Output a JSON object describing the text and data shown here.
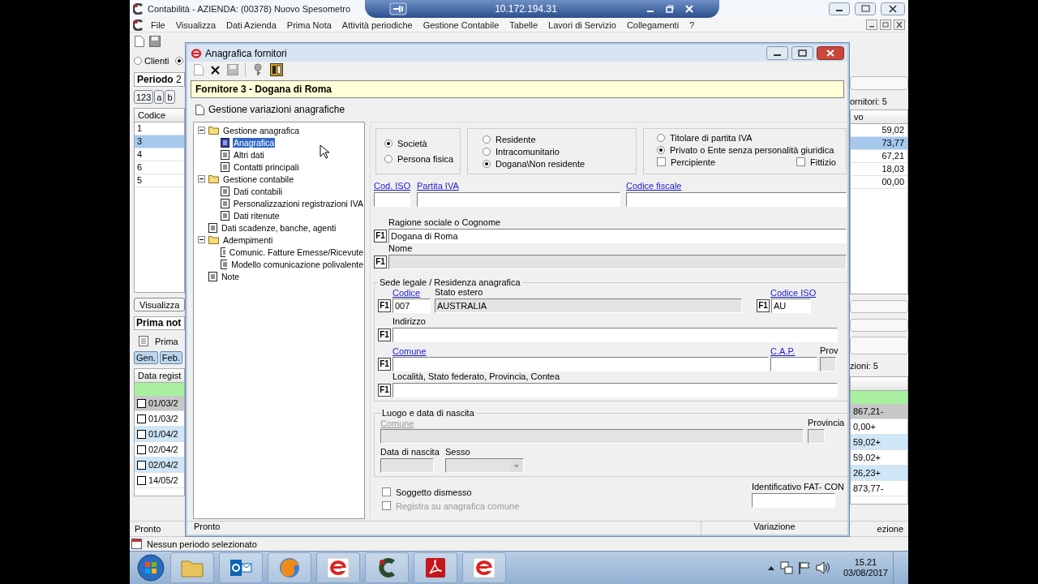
{
  "app": {
    "title": "Contabilità - AZIENDA:  (00378) Nuovo Spesometro",
    "menu": [
      "File",
      "Visualizza",
      "Dati Azienda",
      "Prima Nota",
      "Attività periodiche",
      "Gestione Contabile",
      "Tabelle",
      "Lavori di Servizio",
      "Collegamenti",
      "?"
    ],
    "filter_radios": [
      {
        "label": "Clienti",
        "selected": false
      },
      {
        "selected": true
      }
    ],
    "period_label": "Periodo",
    "period_value": "2",
    "index_buttons": [
      "123",
      "a",
      "b"
    ],
    "suppliers": {
      "column": "Codice",
      "count": "ornitori: 5",
      "column_2": "vo",
      "rows": [
        {
          "code": "1",
          "amount": "59,02",
          "selected": false
        },
        {
          "code": "3",
          "amount": "73,77",
          "selected": true
        },
        {
          "code": "4",
          "amount": "67,21",
          "selected": false
        },
        {
          "code": "6",
          "amount": "18,03",
          "selected": false
        },
        {
          "code": "5",
          "amount": "00,00",
          "selected": false
        }
      ]
    },
    "view_button": "Visualizza",
    "journal_title": "Prima not",
    "journal_item": "Prima",
    "month_tabs": [
      "Gen.",
      "Feb."
    ],
    "journal": {
      "column": "Data regist",
      "count": "zioni: 5",
      "rows": [
        {
          "date": "01/03/2",
          "amount": "867,21-",
          "selected": true
        },
        {
          "date": "01/03/2",
          "amount": "0,00+",
          "selected": false
        },
        {
          "date": "01/04/2",
          "amount": "59,02+",
          "selected": false
        },
        {
          "date": "02/04/2",
          "amount": "59,02+",
          "selected": false
        },
        {
          "date": "02/04/2",
          "amount": "26,23+",
          "selected": false
        },
        {
          "date": "14/05/2",
          "amount": "873,77-",
          "selected": false
        }
      ]
    },
    "status": "Pronto",
    "status_right": "ezione",
    "status_2": "Nessun periodo selezionato"
  },
  "remote_bar": {
    "address": "10.172.194.31"
  },
  "dialog": {
    "title": "Anagrafica fornitori",
    "header": "Fornitore 3 - Dogana di Roma",
    "link": "Gestione variazioni anagrafiche",
    "tree": [
      {
        "label": "Gestione anagrafica",
        "kind": "folder",
        "expanded": true,
        "selected": false,
        "children": [
          {
            "label": "Anagrafica",
            "kind": "page",
            "selected": true
          },
          {
            "label": "Altri dati",
            "kind": "page",
            "selected": false
          },
          {
            "label": "Contatti principali",
            "kind": "page",
            "selected": false
          }
        ]
      },
      {
        "label": "Gestione contabile",
        "kind": "folder",
        "expanded": true,
        "selected": false,
        "children": [
          {
            "label": "Dati contabili",
            "kind": "page",
            "selected": false
          },
          {
            "label": "Personalizzazioni registrazioni IVA",
            "kind": "page",
            "selected": false
          },
          {
            "label": "Dati ritenute",
            "kind": "page",
            "selected": false
          }
        ]
      },
      {
        "label": "Dati scadenze, banche, agenti",
        "kind": "page",
        "selected": false
      },
      {
        "label": "Adempimenti",
        "kind": "folder",
        "expanded": true,
        "selected": false,
        "children": [
          {
            "label": "Comunic. Fatture Emesse/Ricevute",
            "kind": "page",
            "selected": false
          },
          {
            "label": "Modello comunicazione polivalente",
            "kind": "page",
            "selected": false
          }
        ]
      },
      {
        "label": "Note",
        "kind": "page",
        "selected": false
      }
    ],
    "subject_type": [
      {
        "label": "Società",
        "selected": true
      },
      {
        "label": "Persona fisica",
        "selected": false
      }
    ],
    "residence": [
      {
        "label": "Residente",
        "selected": false
      },
      {
        "label": "Intracomunitario",
        "selected": false
      },
      {
        "label": "Dogana\\Non residente",
        "selected": true
      }
    ],
    "vat_status": [
      {
        "label": "Titolare di partita IVA",
        "selected": false
      },
      {
        "label": "Privato o Ente senza personalità giuridica",
        "selected": true
      }
    ],
    "flags": [
      {
        "label": "Percipiente",
        "checked": false
      },
      {
        "label": "Fittizio",
        "checked": false
      }
    ],
    "iso_label": "Cod. ISO",
    "vat_label": "Partita IVA",
    "tax_code_label": "Codice fiscale",
    "company_name": {
      "label": "Ragione sociale o Cognome",
      "value": "Dogana di Roma",
      "key": "F1"
    },
    "name": {
      "label": "Nome",
      "key": "F1",
      "disabled": true
    },
    "seat": {
      "title": "Sede legale / Residenza anagrafica",
      "code": {
        "label": "Codice",
        "value": "007",
        "key": "F1"
      },
      "country": {
        "label": "Stato estero",
        "value": "AUSTRALIA"
      },
      "iso": {
        "label": "Codice ISO",
        "value": "AU",
        "key": "F1"
      },
      "address": {
        "label": "Indirizzo",
        "key": "F1"
      },
      "city": {
        "label": "Comune",
        "key": "F1"
      },
      "zip": {
        "label": "C.A.P."
      },
      "prov": {
        "label": "Prov"
      },
      "locality": {
        "label": "Località, Stato federato, Provincia, Contea",
        "key": "F1"
      }
    },
    "birth": {
      "title": "Luogo e data di nascita",
      "city": "Comune",
      "province": "Provincia",
      "date": "Data di nascita",
      "sex": "Sesso"
    },
    "dismissed": {
      "label": "Soggetto dismesso",
      "checked": false
    },
    "register": {
      "label": "Registra su anagrafica comune",
      "checked": false,
      "disabled": true
    },
    "fat_id": "Identificativo FAT- CON",
    "status": "Pronto",
    "status_mode": "Variazione"
  },
  "taskbar": {
    "apps": [
      {
        "kind": "folder"
      },
      {
        "kind": "mail"
      },
      {
        "kind": "browser"
      },
      {
        "kind": "e-app"
      },
      {
        "kind": "c-app"
      },
      {
        "kind": "pdf"
      },
      {
        "kind": "e-app"
      }
    ],
    "time": "15.21",
    "date": "03/08/2017"
  }
}
